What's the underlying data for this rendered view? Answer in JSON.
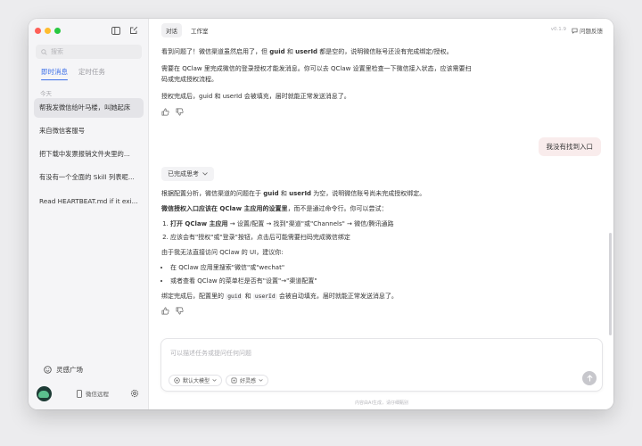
{
  "sidebar": {
    "search_placeholder": "搜索",
    "tabs": [
      {
        "label": "即时消息",
        "active": true
      },
      {
        "label": "定时任务",
        "active": false
      }
    ],
    "day_label": "今天",
    "conversations": [
      {
        "title": "帮我发微信给叶马楼，叫她起床",
        "selected": true
      },
      {
        "title": "来自微信客服号",
        "selected": false
      },
      {
        "title": "把下载中发票报销文件夹里的...",
        "selected": false
      },
      {
        "title": "有没有一个全面的 Skill 列表呢...",
        "selected": false
      },
      {
        "title": "Read HEARTBEAT.md if it exi...",
        "selected": false
      }
    ],
    "inspiration_label": "灵感广场",
    "remote_label": "微信远程"
  },
  "header": {
    "tabs": [
      {
        "label": "对话",
        "active": true
      },
      {
        "label": "工作室",
        "active": false
      }
    ],
    "version": "v0.1.9",
    "feedback_label": "问题反馈"
  },
  "messages": {
    "assistant_1": {
      "p1_a": "看到问题了！微信渠道虽然启用了，但 ",
      "p1_guid": "guid",
      "p1_and": " 和 ",
      "p1_userid": "userId",
      "p1_b": " 都是空的，说明微信账号还没有完成绑定/授权。",
      "p2": "需要在 QClaw 里完成微信的登录授权才能发消息。你可以去 QClaw 设置里检查一下微信接入状态，应该需要扫码或完成授权流程。",
      "p3": "授权完成后，guid 和 userId 会被填充，届时就能正常发送消息了。"
    },
    "user_1": "我没有找到入口",
    "thinking_label": "已完成思考",
    "assistant_2": {
      "p1_a": "根据配置分析，微信渠道的问题在于 ",
      "p1_guid": "guid",
      "p1_and": " 和 ",
      "p1_userid": "userId",
      "p1_b": " 为空，说明微信账号尚未完成授权绑定。",
      "p2_bold": "微信授权入口应该在 QClaw 主应用的设置里",
      "p2_rest": "，而不是通过命令行。你可以尝试：",
      "step1_bold": "打开 QClaw 主应用",
      "step1_rest": " → 设置/配置 → 找到\"渠道\"或\"Channels\" → 微信/腾讯通路",
      "step2": "应该会有\"授权\"或\"登录\"按钮，点击后可能需要扫码完成微信绑定",
      "p3": "由于我无法直接访问 QClaw 的 UI，建议你:",
      "bullet1": "在 QClaw 应用里搜索\"微信\"或\"wechat\"",
      "bullet2": "或者查看 QClaw 的菜单栏是否有\"设置\"→\"渠道配置\"",
      "p4_a": "绑定完成后，配置里的 ",
      "p4_code1": "guid",
      "p4_and": " 和 ",
      "p4_code2": "userId",
      "p4_b": " 会被自动填充，届时就能正常发送消息了。"
    }
  },
  "composer": {
    "placeholder": "可以描述任务或提问任何问题",
    "model_label": "默认大模型",
    "skill_label": "好灵感"
  },
  "disclaimer": "内容由AI生成，请仔细甄别",
  "colors": {
    "accent": "#3b6fe8",
    "user_bubble": "#f9ecec",
    "sidebar_bg": "#f5f5f7"
  }
}
